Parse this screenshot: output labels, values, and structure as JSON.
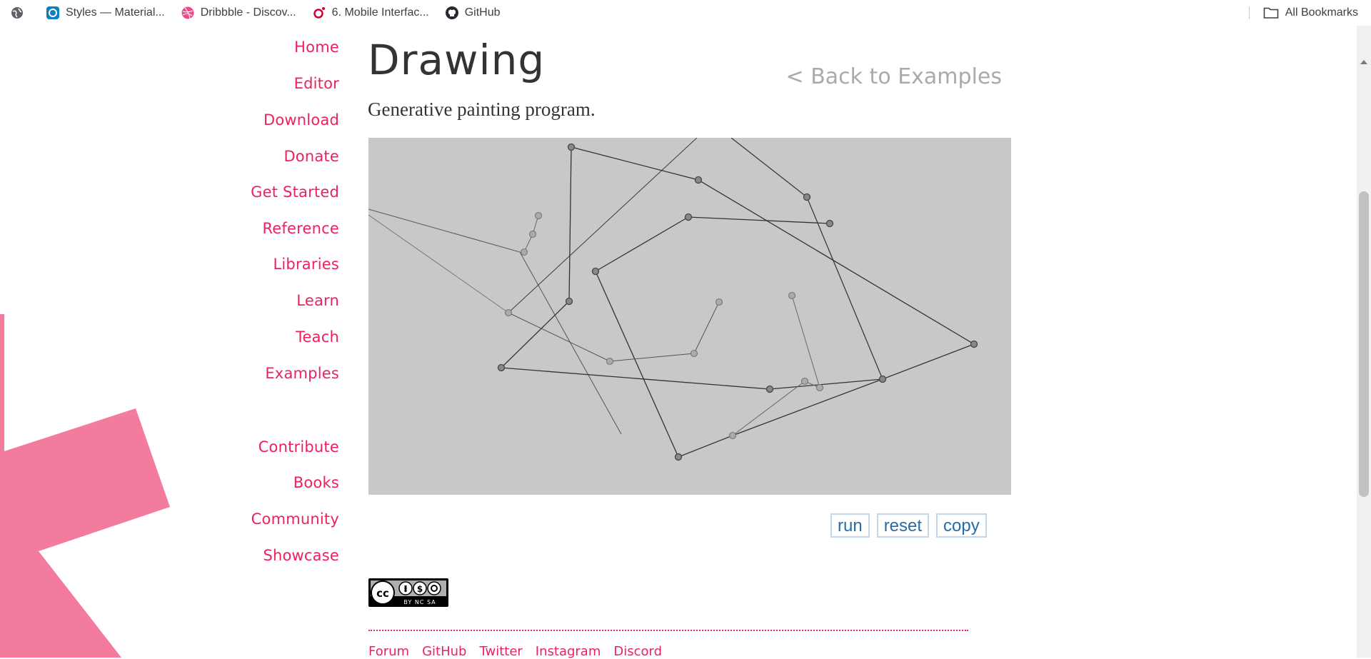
{
  "bookmarks": {
    "items": [
      {
        "label": "",
        "icon": "globe-icon"
      },
      {
        "label": "Styles — Material...",
        "icon": "material-icon"
      },
      {
        "label": "Dribbble - Discov...",
        "icon": "dribbble-icon"
      },
      {
        "label": "6. Mobile Interfac...",
        "icon": "oreilly-icon"
      },
      {
        "label": "GitHub",
        "icon": "github-icon"
      }
    ],
    "all_bookmarks": "All Bookmarks"
  },
  "nav": {
    "primary": [
      "Home",
      "Editor",
      "Download",
      "Donate",
      "Get Started",
      "Reference",
      "Libraries",
      "Learn",
      "Teach",
      "Examples"
    ],
    "secondary": [
      "Contribute",
      "Books",
      "Community",
      "Showcase"
    ]
  },
  "main": {
    "title": "Drawing",
    "back_link": "< Back to Examples",
    "description": "Generative painting program."
  },
  "buttons": {
    "run": "run",
    "reset": "reset",
    "copy": "copy"
  },
  "license": {
    "badge_text": "BY NC SA"
  },
  "footer": {
    "links": [
      "Forum",
      "GitHub",
      "Twitter",
      "Instagram",
      "Discord"
    ]
  },
  "colors": {
    "accent": "#ED225D",
    "canvas_bg": "#C8C8C8",
    "asterisk": "#F37B9D",
    "button_text": "#2B6BA5"
  }
}
